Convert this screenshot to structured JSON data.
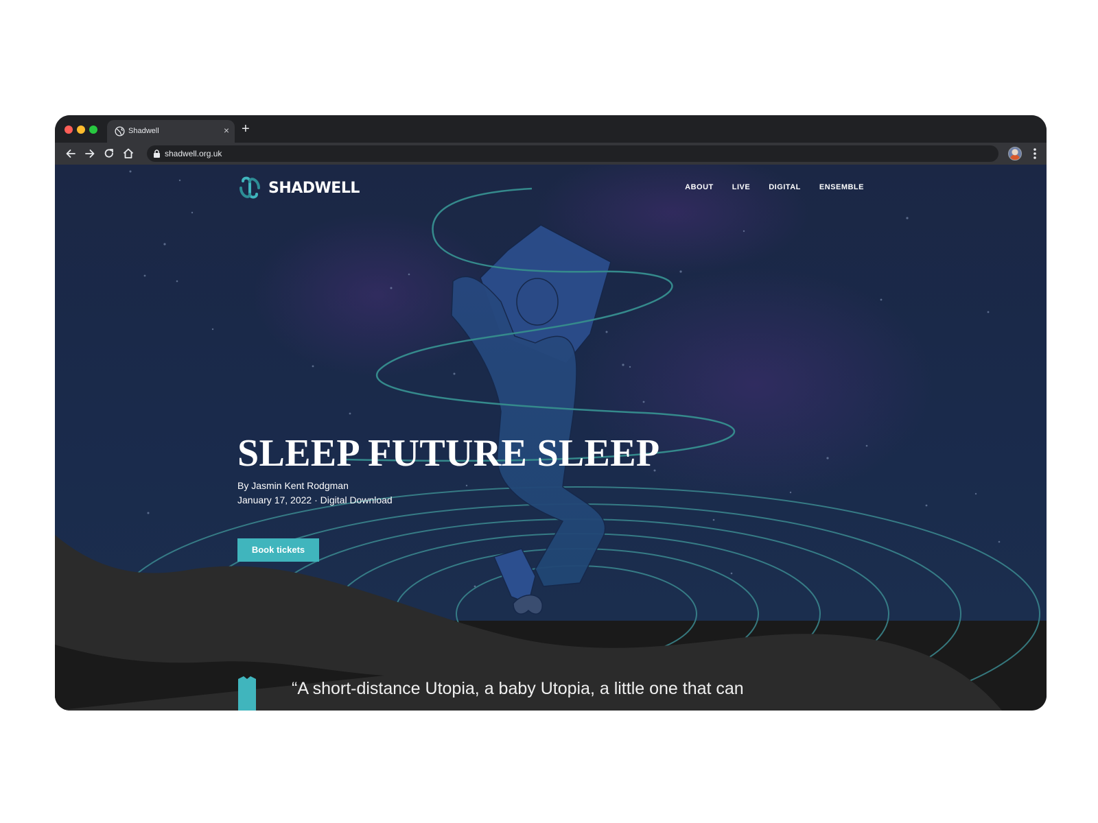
{
  "browser": {
    "tab_title": "Shadwell",
    "tab_icon": "globe-icon",
    "url": "shadwell.org.uk"
  },
  "site": {
    "logo_text": "SHADWELL",
    "nav": [
      "ABOUT",
      "LIVE",
      "DIGITAL",
      "ENSEMBLE"
    ]
  },
  "hero": {
    "title": "SLEEP FUTURE SLEEP",
    "byline": "By Jasmin Kent Rodgman",
    "date": "January 17, 2022",
    "separator": "·",
    "format": "Digital Download",
    "cta_label": "Book tickets"
  },
  "quote": {
    "text": "“A short-distance Utopia, a baby Utopia, a little one that can"
  },
  "colors": {
    "accent": "#40b5bd",
    "hero_bg": "#1b2745",
    "dark": "#1a1a1a",
    "wave": "#2b2b2b"
  }
}
